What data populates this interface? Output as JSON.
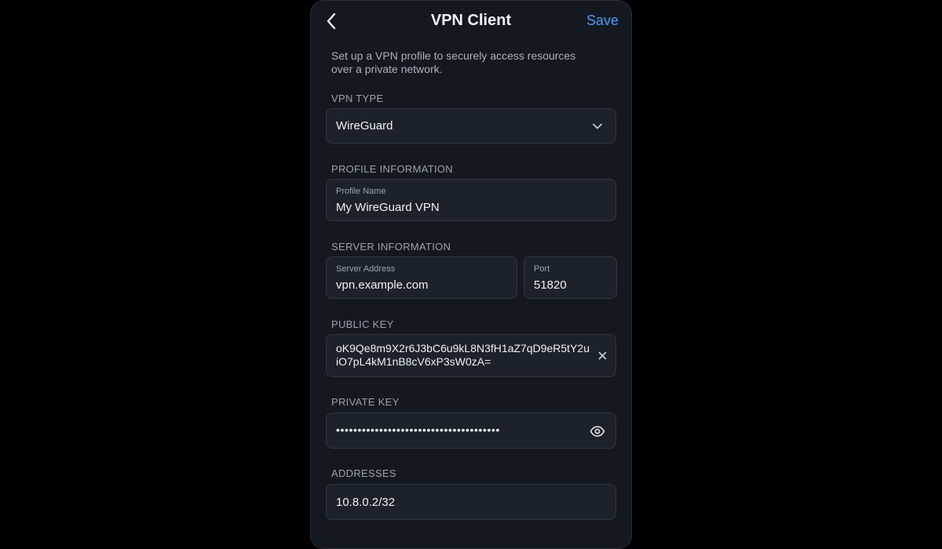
{
  "nav": {
    "title": "VPN Client",
    "save_label": "Save",
    "back_icon": "chevron-left-icon"
  },
  "intro": "Set up a VPN profile to securely access resources over a private network.",
  "vpn_type": {
    "section_label": "VPN TYPE",
    "selected": "WireGuard"
  },
  "profile": {
    "section_label": "PROFILE INFORMATION",
    "name_label": "Profile Name",
    "name_value": "My WireGuard VPN"
  },
  "server": {
    "section_label": "SERVER INFORMATION",
    "address_label": "Server Address",
    "address_value": "vpn.example.com",
    "port_label": "Port",
    "port_value": "51820"
  },
  "public_key": {
    "section_label": "PUBLIC KEY",
    "value": "oK9Qe8m9X2r6J3bC6u9kL8N3fH1aZ7qD9eR5tY2uiO7pL4kM1nB8cV6xP3sW0zA="
  },
  "private_key": {
    "section_label": "PRIVATE KEY",
    "masked_value": "••••••••••••••••••••••••••••••••••••••"
  },
  "addresses": {
    "section_label": "ADDRESSES",
    "value": "10.8.0.2/32"
  },
  "colors": {
    "accent": "#4a9bf5",
    "background": "#131821",
    "field": "#1c222c"
  }
}
